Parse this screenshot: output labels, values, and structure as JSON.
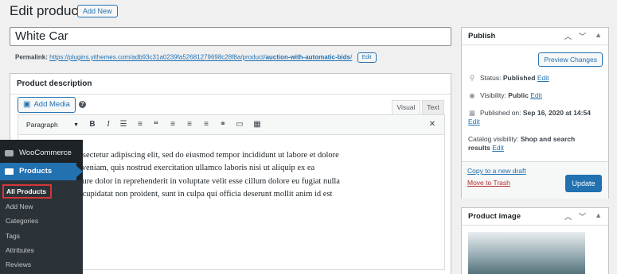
{
  "header": {
    "title": "Edit product",
    "add_new": "Add New"
  },
  "title_field": {
    "value": "White Car"
  },
  "permalink": {
    "label": "Permalink:",
    "url_prefix": "https://plugins.yithemes.com/adb93c31a0239fa52681279698c28f8a/product/",
    "slug": "auction-with-automatic-bids",
    "url_suffix": "/",
    "edit": "Edit"
  },
  "description": {
    "heading": "Product description",
    "add_media": "Add Media",
    "help": "?",
    "tab_visual": "Visual",
    "tab_text": "Text",
    "format": "Paragraph",
    "text": "olor sit amet, consectetur adipiscing elit, sed do eiusmod tempor incididunt ut labore et dolore t enim ad minim veniam, quis nostrud exercitation ullamco laboris nisi ut aliquip ex ea quat. Duis aute irure dolor in reprehenderit in voluptate velit esse cillum dolore eu fugiat nulla eur sint occaecat cupidatat non proident, sunt in culpa qui officia deserunt mollit anim id est",
    "lines": [
      "olor sit amet, consectetur adipiscing elit, sed do eiusmod tempor incididunt ut labore et dolore",
      "t enim ad minim veniam, quis nostrud exercitation ullamco laboris nisi ut aliquip ex ea",
      "quat. Duis aute irure dolor in reprehenderit in voluptate velit esse cillum dolore eu fugiat nulla",
      "eur sint occaecat cupidatat non proident, sunt in culpa qui officia deserunt mollit anim id est"
    ],
    "toolbar_icons": [
      "bold-icon",
      "italic-icon",
      "bullet-list-icon",
      "numbered-list-icon",
      "blockquote-icon",
      "align-left-icon",
      "align-center-icon",
      "align-right-icon",
      "link-icon",
      "horizontal-rule-icon",
      "keyboard-icon",
      "fullscreen-icon"
    ]
  },
  "publish": {
    "heading": "Publish",
    "preview": "Preview Changes",
    "status_label": "Status:",
    "status_value": "Published",
    "visibility_label": "Visibility:",
    "visibility_value": "Public",
    "published_label": "Published on:",
    "published_value": "Sep 16, 2020 at 14:54",
    "catalog_label": "Catalog visibility:",
    "catalog_value": "Shop and search",
    "catalog_value2": "results",
    "edit": "Edit",
    "copy_draft": "Copy to a new draft",
    "trash": "Move to Trash",
    "update": "Update"
  },
  "product_image": {
    "heading": "Product image"
  },
  "admin_menu": {
    "woocommerce": "WooCommerce",
    "products": "Products",
    "submenu": [
      "All Products",
      "Add New",
      "Categories",
      "Tags",
      "Attributes",
      "Reviews"
    ]
  },
  "colors": {
    "accent": "#2271b1",
    "menu_bg": "#1d2327",
    "submenu_bg": "#2c3338",
    "trash": "#b32d2e",
    "highlight": "#d63638"
  }
}
